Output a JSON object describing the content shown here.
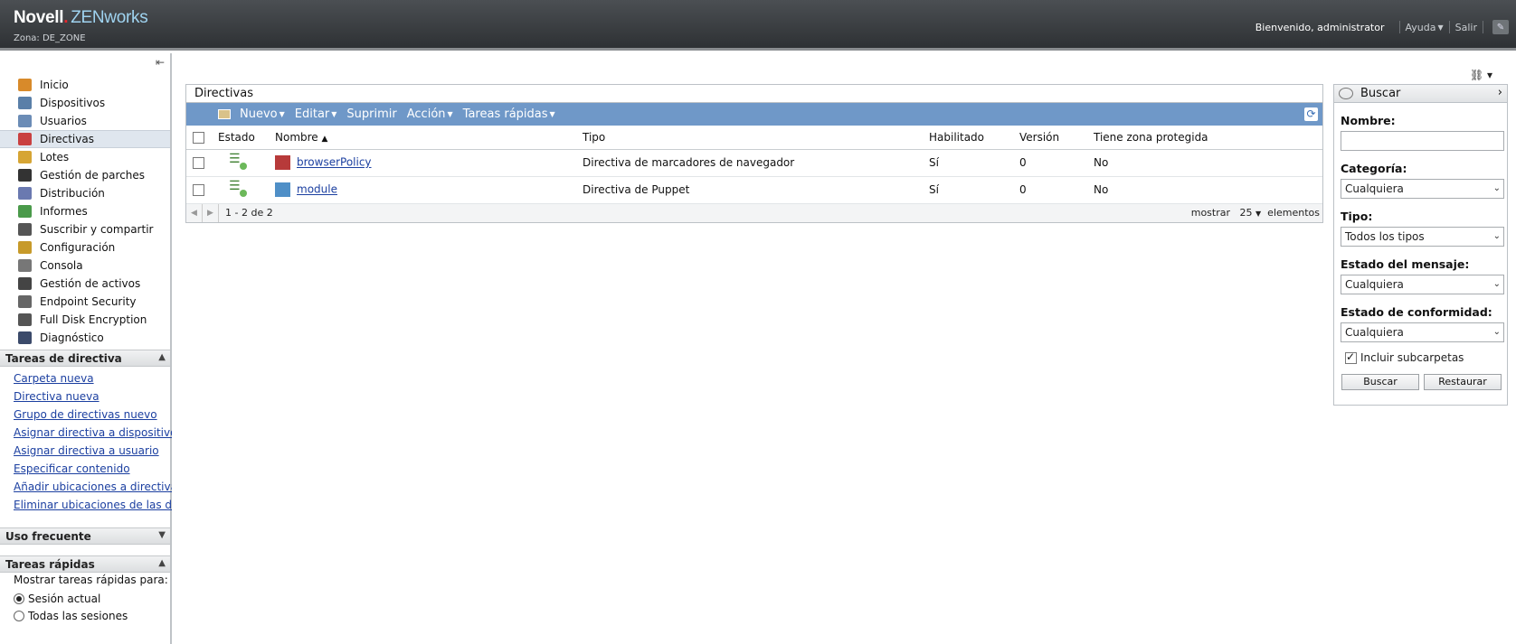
{
  "header": {
    "brand_novell": "Novell",
    "brand_dot": ".",
    "brand_zenworks": "ZENworks",
    "zone": "Zona: DE_ZONE",
    "welcome": "Bienvenido, administrator",
    "help": "Ayuda",
    "logout": "Salir"
  },
  "nav": {
    "items": [
      {
        "label": "Inicio",
        "icon": "home-icon",
        "color": "#d88a2a"
      },
      {
        "label": "Dispositivos",
        "icon": "devices-icon",
        "color": "#5a7fa8"
      },
      {
        "label": "Usuarios",
        "icon": "users-icon",
        "color": "#6b8cb6"
      },
      {
        "label": "Directivas",
        "icon": "policies-icon",
        "color": "#c94040"
      },
      {
        "label": "Lotes",
        "icon": "bundles-icon",
        "color": "#d6a534"
      },
      {
        "label": "Gestión de parches",
        "icon": "patch-icon",
        "color": "#333333"
      },
      {
        "label": "Distribución",
        "icon": "distribution-icon",
        "color": "#6a79b0"
      },
      {
        "label": "Informes",
        "icon": "reports-icon",
        "color": "#4a9a4a"
      },
      {
        "label": "Suscribir y compartir",
        "icon": "subscribe-icon",
        "color": "#555555"
      },
      {
        "label": "Configuración",
        "icon": "configuration-icon",
        "color": "#c79a2a"
      },
      {
        "label": "Consola",
        "icon": "console-icon",
        "color": "#777777"
      },
      {
        "label": "Gestión de activos",
        "icon": "asset-icon",
        "color": "#444444"
      },
      {
        "label": "Endpoint Security",
        "icon": "endpoint-security-icon",
        "color": "#666666"
      },
      {
        "label": "Full Disk Encryption",
        "icon": "disk-encryption-icon",
        "color": "#555555"
      },
      {
        "label": "Diagnóstico",
        "icon": "diagnostics-icon",
        "color": "#3b4a6a"
      }
    ],
    "active_index": 3
  },
  "policy_tasks": {
    "title": "Tareas de directiva",
    "items": [
      "Carpeta nueva",
      "Directiva nueva",
      "Grupo de directivas nuevo",
      "Asignar directiva a dispositivo",
      "Asignar directiva a usuario",
      "Especificar contenido",
      "Añadir ubicaciones a directivas",
      "Eliminar ubicaciones de las directivas"
    ]
  },
  "frequent": {
    "title": "Uso frecuente"
  },
  "quick_tasks": {
    "title": "Tareas rápidas",
    "show_for": "Mostrar tareas rápidas para:",
    "current_session": "Sesión actual",
    "all_sessions": "Todas las sesiones"
  },
  "main": {
    "title": "Directivas",
    "actions": {
      "new": "Nuevo",
      "edit": "Editar",
      "delete": "Suprimir",
      "action": "Acción",
      "quick": "Tareas rápidas"
    },
    "columns": {
      "status": "Estado",
      "name": "Nombre",
      "type": "Tipo",
      "enabled": "Habilitado",
      "version": "Versión",
      "sandbox": "Tiene zona protegida"
    },
    "rows": [
      {
        "name": "browserPolicy",
        "type": "Directiva de marcadores de navegador",
        "enabled": "Sí",
        "version": "0",
        "sandbox": "No"
      },
      {
        "name": "module",
        "type": "Directiva de Puppet",
        "enabled": "Sí",
        "version": "0",
        "sandbox": "No"
      }
    ],
    "pager": {
      "range": "1 - 2 de 2",
      "show": "mostrar",
      "count": "25",
      "items": "elementos"
    }
  },
  "search": {
    "title": "Buscar",
    "name_label": "Nombre:",
    "name_value": "",
    "category_label": "Categoría:",
    "category_value": "Cualquiera",
    "type_label": "Tipo:",
    "type_value": "Todos los tipos",
    "message_label": "Estado del mensaje:",
    "message_value": "Cualquiera",
    "compliance_label": "Estado de conformidad:",
    "compliance_value": "Cualquiera",
    "include_subfolders": "Incluir subcarpetas",
    "search_button": "Buscar",
    "reset_button": "Restaurar"
  }
}
